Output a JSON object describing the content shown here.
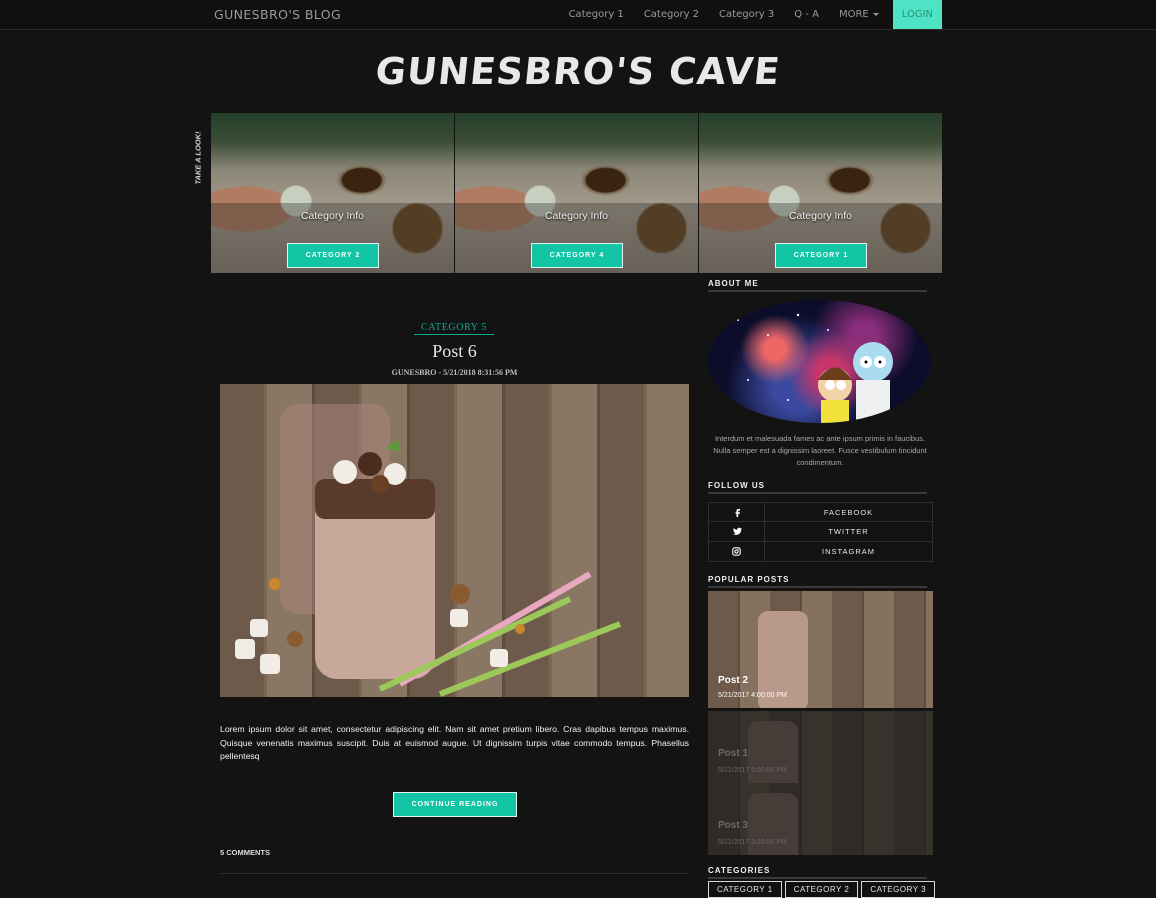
{
  "nav": {
    "brand": "GUNESBRO'S BLOG",
    "items": [
      "Category 1",
      "Category 2",
      "Category 3",
      "Q - A"
    ],
    "more": "MORE",
    "login": "LOGIN"
  },
  "site": {
    "title": "GUNESBRO'S CAVE"
  },
  "carousel": {
    "side_label": "TAKE A LOOK!",
    "slides": [
      {
        "info": "Category Info",
        "button": "CATEGORY 2"
      },
      {
        "info": "Category Info",
        "button": "CATEGORY 4"
      },
      {
        "info": "Category Info",
        "button": "CATEGORY 1"
      }
    ]
  },
  "post": {
    "category": "CATEGORY 5",
    "title": "Post 6",
    "meta": "GUNESBRO - 5/21/2018 8:31:56 PM",
    "excerpt": "Lorem ipsum dolor sit amet, consectetur adipiscing elit. Nam sit amet pretium libero. Cras dapibus tempus maximus. Quisque venenatis maximus suscipit. Duis at euismod augue. Ut dignissim turpis vitae commodo tempus. Phasellus pellentesq",
    "continue": "CONTINUE READING",
    "comments": "5 COMMENTS"
  },
  "sidebar": {
    "about_heading": "ABOUT ME",
    "about_text": "Interdum et malesuada fames ac ante ipsum primis in faucibus. Nulla semper est a dignissim laoreet. Fusce vestibulum tincidunt condimentum.",
    "follow_heading": "FOLLOW US",
    "social": [
      {
        "icon": "facebook-icon",
        "label": "FACEBOOK"
      },
      {
        "icon": "twitter-icon",
        "label": "TWITTER"
      },
      {
        "icon": "instagram-icon",
        "label": "INSTAGRAM"
      }
    ],
    "popular_heading": "POPULAR POSTS",
    "popular": [
      {
        "title": "Post 2",
        "date": "5/21/2017 4:00:00 PM"
      },
      {
        "title": "Post 1",
        "date": "5/21/2017 5:00:00 PM"
      },
      {
        "title": "Post 3",
        "date": "5/21/2017 3:20:00 PM"
      }
    ],
    "categories_heading": "CATEGORIES",
    "categories": [
      "CATEGORY 1",
      "CATEGORY 2",
      "CATEGORY 3"
    ]
  }
}
